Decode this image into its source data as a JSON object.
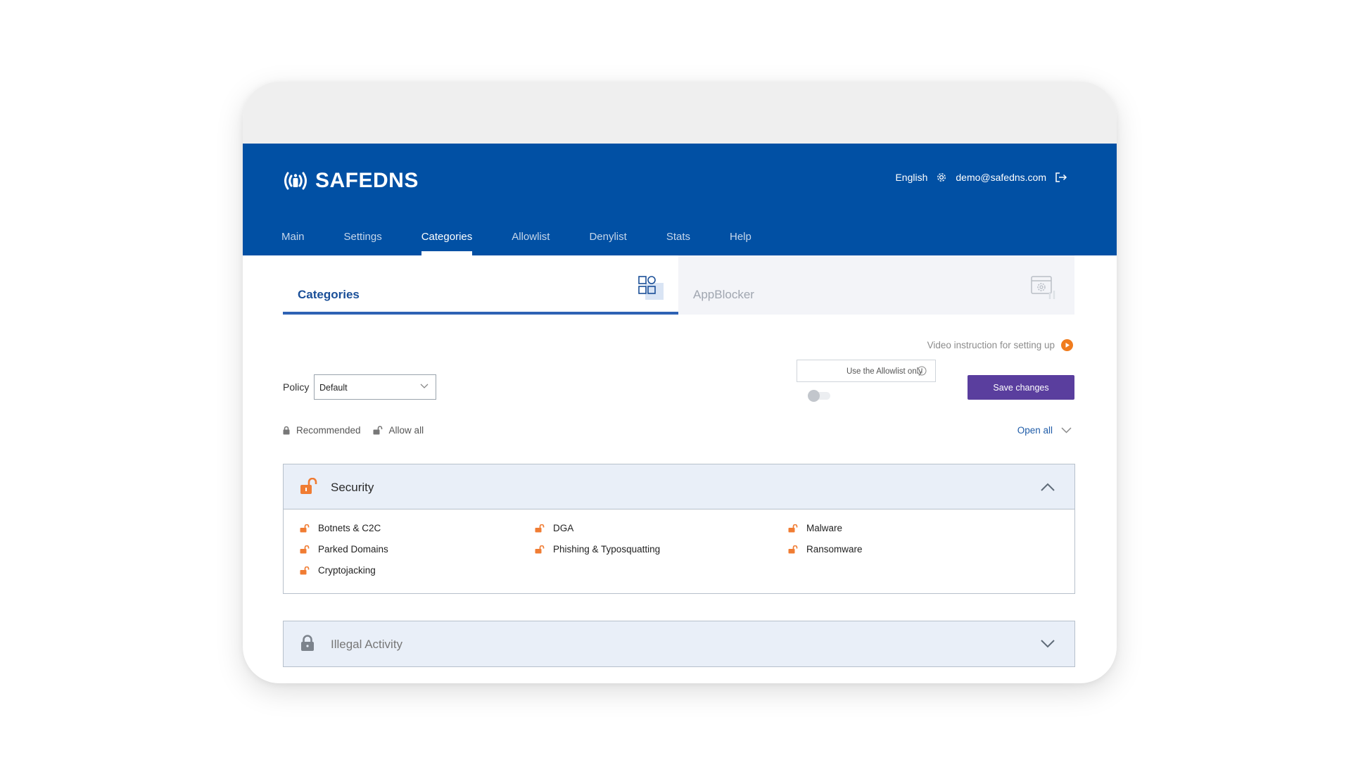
{
  "brand": {
    "name": "SAFEDNS"
  },
  "header": {
    "language": "English",
    "email": "demo@safedns.com"
  },
  "nav": [
    {
      "label": "Main",
      "active": false
    },
    {
      "label": "Settings",
      "active": false
    },
    {
      "label": "Categories",
      "active": true
    },
    {
      "label": "Allowlist",
      "active": false
    },
    {
      "label": "Denylist",
      "active": false
    },
    {
      "label": "Stats",
      "active": false
    },
    {
      "label": "Help",
      "active": false
    }
  ],
  "tabs": {
    "categories": "Categories",
    "appblocker": "AppBlocker"
  },
  "video_instruction": "Video instruction for setting up",
  "policy": {
    "label": "Policy",
    "selected": "Default"
  },
  "allowlist_only": {
    "label": "Use the Allowlist only",
    "enabled": false
  },
  "save_label": "Save  changes",
  "legend": {
    "recommended": "Recommended",
    "allow_all": "Allow all"
  },
  "open_all": "Open all",
  "sections": {
    "security": {
      "title": "Security",
      "expanded": true,
      "items": [
        "Botnets & C2C",
        "DGA",
        "Malware",
        "Parked Domains",
        "Phishing & Typosquatting",
        "Ransomware",
        "Cryptojacking"
      ]
    },
    "illegal": {
      "title": "Illegal Activity",
      "expanded": false
    }
  },
  "colors": {
    "header_blue": "#0150a4",
    "tab_accent": "#2e62b4",
    "save_purple": "#5a3e9e",
    "unlock_orange": "#f07c33",
    "play_orange": "#f07c1e",
    "section_bg": "#e9eff8"
  }
}
